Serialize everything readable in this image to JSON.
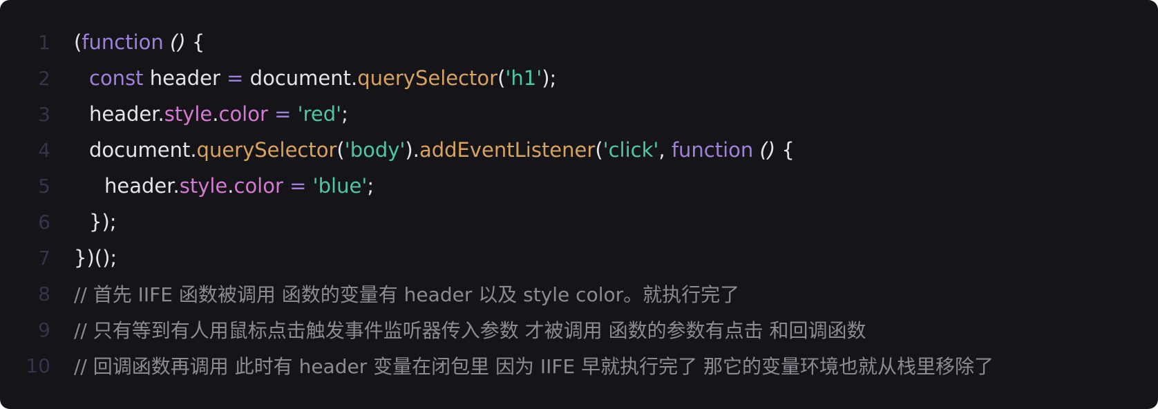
{
  "editor": {
    "background": "#141419",
    "colors": {
      "keyword": "#a180dc",
      "function": "#d8a35f",
      "string": "#4ec7a3",
      "property": "#d57ad0",
      "plain": "#e6e3ec",
      "comment": "#8d8a94",
      "line_number": "#34344a"
    },
    "line_numbers": [
      "1",
      "2",
      "3",
      "4",
      "5",
      "6",
      "7",
      "8",
      "9",
      "10"
    ],
    "lines": {
      "l1": {
        "t0": "(",
        "t1": "function",
        "t2": " ",
        "t3": "()",
        "t4": " {"
      },
      "l2": {
        "t0": "const",
        "t1": " header ",
        "t2": "=",
        "t3": " document.",
        "t4": "querySelector",
        "t5": "(",
        "t6": "'h1'",
        "t7": ");"
      },
      "l3": {
        "t0": "header.",
        "t1": "style",
        "t2": ".",
        "t3": "color",
        "t4": " ",
        "t5": "=",
        "t6": " ",
        "t7": "'red'",
        "t8": ";"
      },
      "l4": {
        "t0": "document.",
        "t1": "querySelector",
        "t2": "(",
        "t3": "'body'",
        "t4": ").",
        "t5": "addEventListener",
        "t6": "(",
        "t7": "'click'",
        "t8": ", ",
        "t9": "function",
        "t10": " ",
        "t11": "()",
        "t12": " {"
      },
      "l5": {
        "t0": "header.",
        "t1": "style",
        "t2": ".",
        "t3": "color",
        "t4": " ",
        "t5": "=",
        "t6": " ",
        "t7": "'blue'",
        "t8": ";"
      },
      "l6": {
        "t0": "});"
      },
      "l7": {
        "t0": "})();"
      },
      "l8": {
        "t0": "// 首先 IIFE 函数被调用 函数的变量有 header 以及 style color。就执行完了"
      },
      "l9": {
        "t0": "// 只有等到有人用鼠标点击触发事件监听器传入参数 才被调用 函数的参数有点击 和回调函数"
      },
      "l10": {
        "t0": "// 回调函数再调用 此时有 header 变量在闭包里 因为 IIFE 早就执行完了 那它的变量环境也就从栈里移除了"
      }
    }
  }
}
